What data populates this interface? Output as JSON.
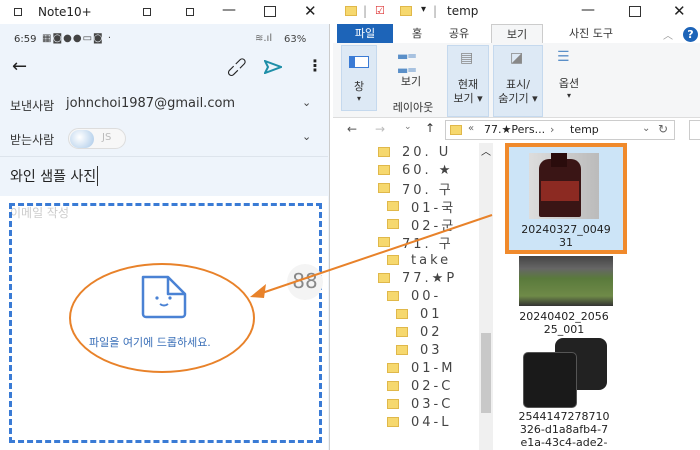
{
  "phone": {
    "window_title": "Note10+",
    "status": {
      "time": "6:59",
      "battery": "63%"
    },
    "from_label": "보낸사람",
    "from_value": "johnchoi1987@gmail.com",
    "to_label": "받는사람",
    "to_chip": "JS",
    "subject": "와인 샘플 사진",
    "body_placeholder": "이메일 작성",
    "drop_text": "파일을 여기에 드롭하세요.",
    "accent": "#3a7bd5",
    "annotation_color": "#e8822a"
  },
  "explorer": {
    "title": "temp",
    "tabs": [
      "파일",
      "홈",
      "공유",
      "보기",
      "사진 도구"
    ],
    "active_tab": "보기",
    "ribbon": {
      "pane": "창",
      "layout": "보기",
      "group_layout": "레이아웃",
      "current_view": [
        "현재",
        "보기 ▾"
      ],
      "show_hide": [
        "표시/",
        "숨기기 ▾"
      ],
      "options": "옵션"
    },
    "address": {
      "prefix": "«",
      "path1": "77.★Pers...",
      "sep": "›",
      "path2": "temp"
    },
    "tree": [
      "20. U",
      "60. ★",
      "70. 구",
      "01-국",
      "02-군",
      "71. 구",
      "take",
      "77.★P",
      "00-",
      "01",
      "02",
      "03",
      "01-M",
      "02-C",
      "03-C",
      "04-L"
    ],
    "files": [
      {
        "name": "20240327_004931",
        "lines": [
          "20240327_0049",
          "31"
        ],
        "selected": true
      },
      {
        "name": "20240402_205625_001",
        "lines": [
          "20240402_2056",
          "25_001"
        ]
      },
      {
        "name": "2544147278710326-d1a8afb4-7e1a-43c4-ade2-",
        "lines": [
          "2544147278710",
          "326-d1a8afb4-7",
          "e1a-43c4-ade2-"
        ]
      }
    ]
  }
}
